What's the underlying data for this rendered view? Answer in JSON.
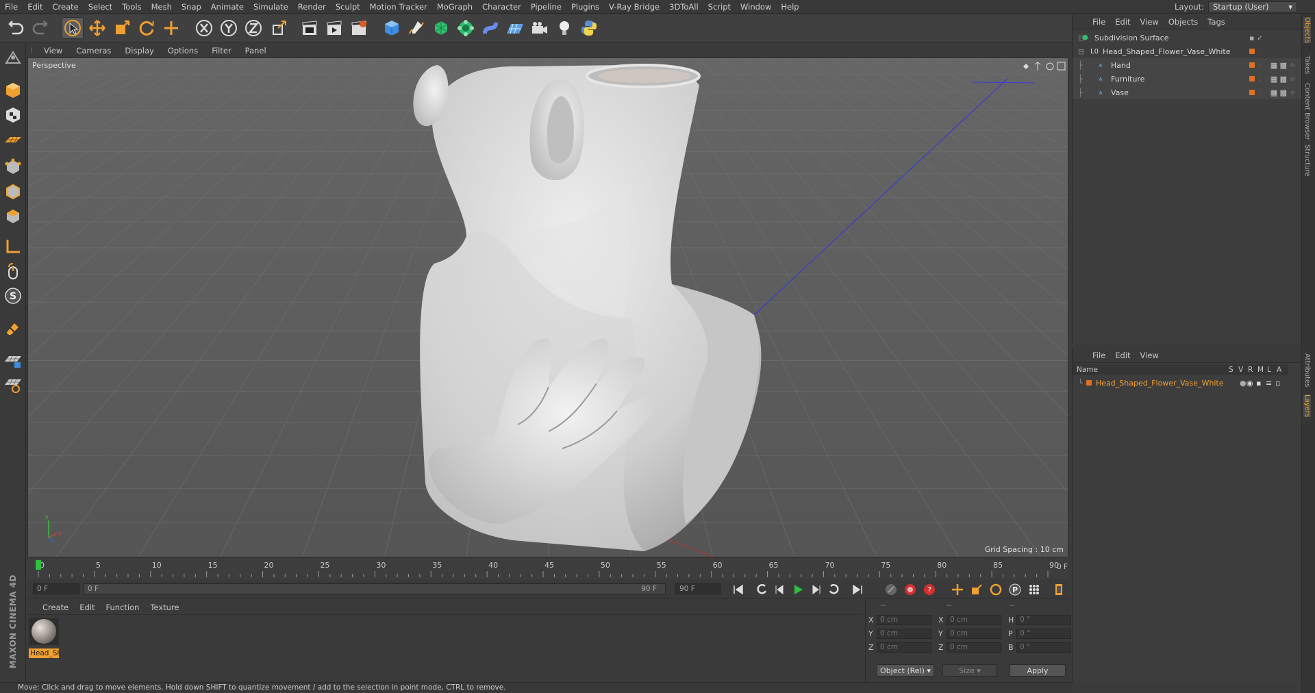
{
  "menubar": {
    "items": [
      "File",
      "Edit",
      "Create",
      "Select",
      "Tools",
      "Mesh",
      "Snap",
      "Animate",
      "Simulate",
      "Render",
      "Sculpt",
      "Motion Tracker",
      "MoGraph",
      "Character",
      "Pipeline",
      "Plugins",
      "V-Ray Bridge",
      "3DToAll",
      "Script",
      "Window",
      "Help"
    ],
    "layout_label": "Layout:",
    "layout_value": "Startup (User)"
  },
  "viewport": {
    "menu": [
      "View",
      "Cameras",
      "Display",
      "Options",
      "Filter",
      "Panel"
    ],
    "label": "Perspective",
    "grid_spacing": "Grid Spacing : 10 cm"
  },
  "timeline": {
    "ticks": [
      "0",
      "5",
      "10",
      "15",
      "20",
      "25",
      "30",
      "35",
      "40",
      "45",
      "50",
      "55",
      "60",
      "65",
      "70",
      "75",
      "80",
      "85",
      "90"
    ],
    "current_frame": "0 F",
    "start_field": "0 F",
    "range_start": "0 F",
    "range_end": "90 F",
    "end_field": "90 F"
  },
  "material_panel": {
    "menu": [
      "Create",
      "Edit",
      "Function",
      "Texture"
    ],
    "material_name": "Head_Sh"
  },
  "coords": {
    "header_left": "--",
    "header_mid": "--",
    "header_right": "--",
    "rows": [
      {
        "a": "X",
        "av": "0 cm",
        "b": "X",
        "bv": "0 cm",
        "c": "H",
        "cv": "0 °"
      },
      {
        "a": "Y",
        "av": "0 cm",
        "b": "Y",
        "bv": "0 cm",
        "c": "P",
        "cv": "0 °"
      },
      {
        "a": "Z",
        "av": "0 cm",
        "b": "Z",
        "bv": "0 cm",
        "c": "B",
        "cv": "0 °"
      }
    ],
    "mode": "Object (Rel)",
    "size": "Size",
    "apply": "Apply"
  },
  "object_manager": {
    "menu": [
      "File",
      "Edit",
      "View",
      "Objects",
      "Tags"
    ],
    "items": [
      {
        "name": "Subdivision Surface",
        "depth": 0
      },
      {
        "name": "Head_Shaped_Flower_Vase_White",
        "depth": 1
      },
      {
        "name": "Hand",
        "depth": 2
      },
      {
        "name": "Furniture",
        "depth": 2
      },
      {
        "name": "Vase",
        "depth": 2
      }
    ]
  },
  "layers": {
    "menu": [
      "File",
      "Edit",
      "View"
    ],
    "cols": [
      "Name",
      "S",
      "V",
      "R",
      "M",
      "L",
      "A"
    ],
    "row_name": "Head_Shaped_Flower_Vase_White"
  },
  "right_tabs": [
    "Objects",
    "Takes",
    "Content Browser",
    "Structure",
    "Attributes",
    "Layers"
  ],
  "maxon": "MAXON CINEMA 4D",
  "status": "Move: Click and drag to move elements. Hold down SHIFT to quantize movement / add to the selection in point mode, CTRL to remove.",
  "colors": {
    "accent": "#f0a030",
    "orange_dot": "#e07020",
    "select": "#3d8ee0"
  }
}
